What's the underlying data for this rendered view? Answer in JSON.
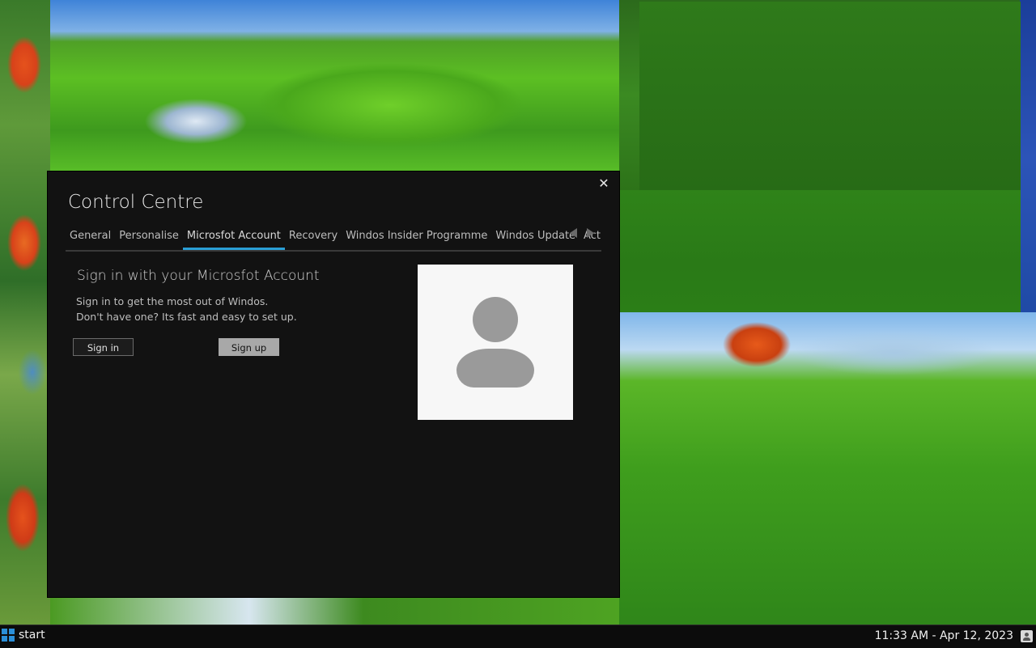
{
  "window": {
    "title": "Control Centre",
    "close_label": "✕",
    "tabs": [
      {
        "label": "General"
      },
      {
        "label": "Personalise"
      },
      {
        "label": "Microsfot Account"
      },
      {
        "label": "Recovery"
      },
      {
        "label": "Windos Insider Programme"
      },
      {
        "label": "Windos Update"
      },
      {
        "label": "Acti"
      }
    ],
    "active_tab": "Microsfot Account",
    "content": {
      "heading": "Sign in with your Microsfot Account",
      "line1": "Sign in to get the most out of Windos.",
      "line2": "Don't have one? Its fast and easy to set up.",
      "signin_label": "Sign in",
      "signup_label": "Sign up"
    }
  },
  "taskbar": {
    "start_label": "start",
    "clock": "11:33 AM - Apr 12, 2023"
  },
  "colors": {
    "window_bg": "#121212",
    "accent": "#2a9fd6",
    "taskbar_bg": "#0c0c0c"
  }
}
